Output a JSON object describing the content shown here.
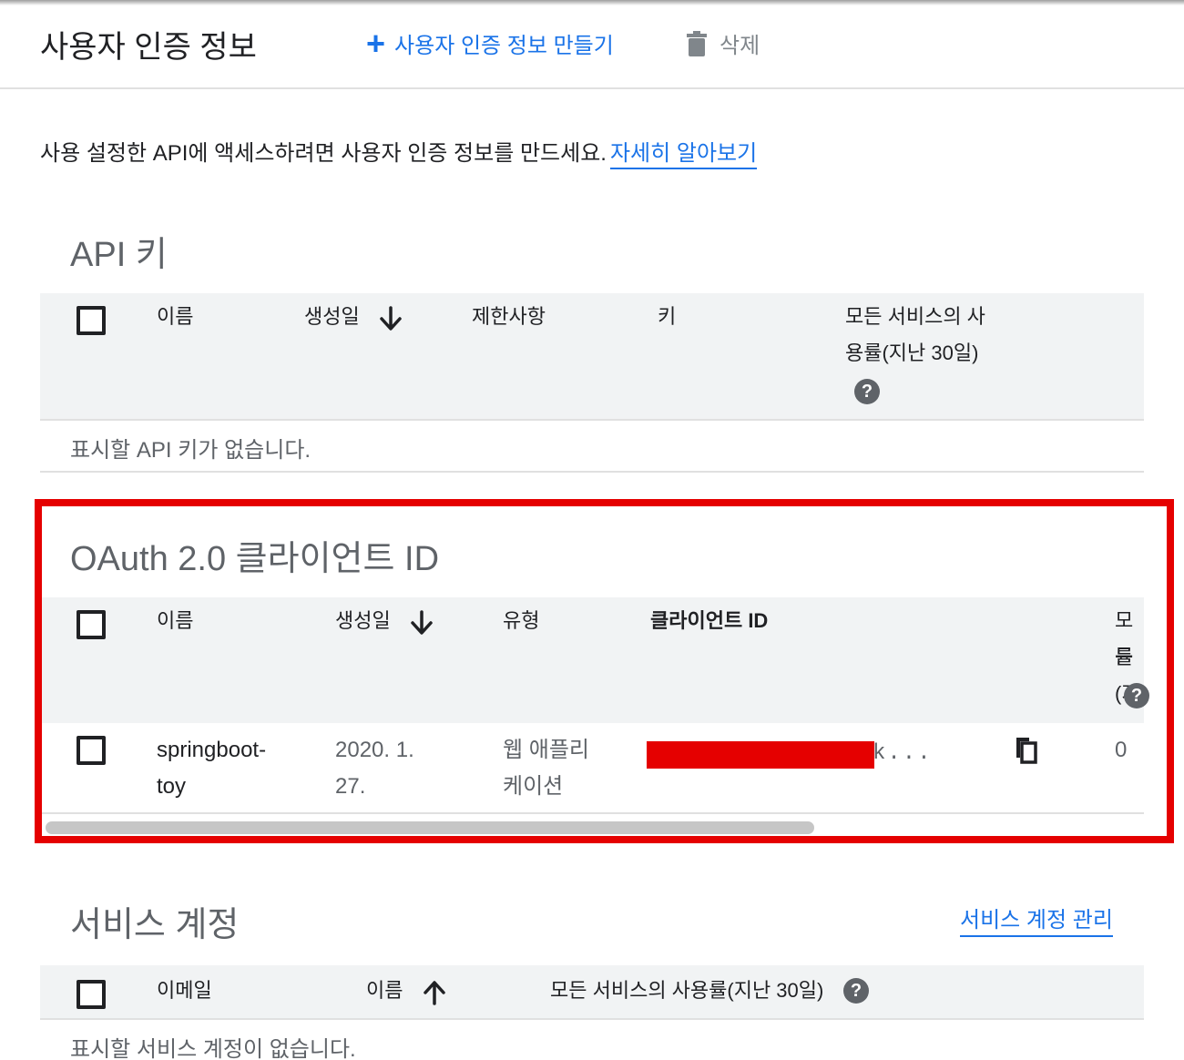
{
  "header": {
    "title": "사용자 인증 정보",
    "create_label": "사용자 인증 정보 만들기",
    "delete_label": "삭제"
  },
  "intro": {
    "text": "사용 설정한 API에 액세스하려면 사용자 인증 정보를 만드세요.",
    "link": "자세히 알아보기"
  },
  "api_keys": {
    "title": "API 키",
    "columns": {
      "name": "이름",
      "created": "생성일",
      "restrictions": "제한사항",
      "key": "키",
      "usage_line1": "모든 서비스의 사",
      "usage_line2": "용률(지난 30일)"
    },
    "empty": "표시할 API 키가 없습니다."
  },
  "oauth": {
    "title": "OAuth 2.0 클라이언트 ID",
    "columns": {
      "name": "이름",
      "created": "생성일",
      "type": "유형",
      "client_id": "클라이언트 ID",
      "usage_line1": "모든",
      "usage_line2": "률(지"
    },
    "rows": [
      {
        "name_line1": "springboot-",
        "name_line2": "toy",
        "created_line1": "2020. 1.",
        "created_line2": "27.",
        "type_line1": "웹 애플리",
        "type_line2": "케이션",
        "client_id_suffix": "k...",
        "usage": "0"
      }
    ]
  },
  "service_accounts": {
    "title": "서비스 계정",
    "manage_link": "서비스 계정 관리",
    "columns": {
      "email": "이메일",
      "name": "이름",
      "usage": "모든 서비스의 사용률(지난 30일)"
    },
    "empty": "표시할 서비스 계정이 없습니다."
  },
  "colors": {
    "accent": "#1a73e8",
    "highlight": "#e50000",
    "header_bg": "#f1f3f4"
  }
}
